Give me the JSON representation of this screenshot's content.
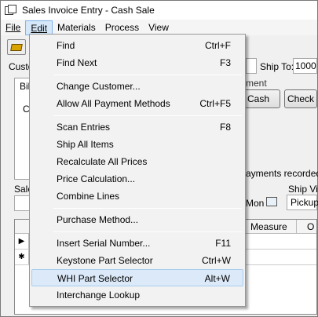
{
  "window": {
    "title": "Sales Invoice Entry - Cash Sale"
  },
  "menubar": {
    "file": "File",
    "edit": "Edit",
    "materials": "Materials",
    "process": "Process",
    "view": "View"
  },
  "form": {
    "customer_label": "Custo",
    "ship_to_label": "Ship To:",
    "ship_to_value": "1000",
    "payment_label": "ment",
    "cash_label": "Cash",
    "check_label": "Check",
    "bill_label": "Bil",
    "c_label": "C",
    "payments_text": "ayments recorded.",
    "sales_label": "Sale",
    "ship_via_label": "Ship Via",
    "mon_label": "Mon",
    "pickup_label": "Pickup"
  },
  "grid": {
    "measure_header": "Measure",
    "o_header": "O",
    "row1_marker": "▶",
    "row2_marker": "✱"
  },
  "edit_menu": {
    "items": [
      {
        "label": "Find",
        "shortcut": "Ctrl+F"
      },
      {
        "label": "Find Next",
        "shortcut": "F3"
      },
      {
        "label": "Change Customer...",
        "shortcut": ""
      },
      {
        "label": "Allow All Payment Methods",
        "shortcut": "Ctrl+F5"
      },
      {
        "label": "Scan Entries",
        "shortcut": "F8"
      },
      {
        "label": "Ship All Items",
        "shortcut": ""
      },
      {
        "label": "Recalculate All Prices",
        "shortcut": ""
      },
      {
        "label": "Price Calculation...",
        "shortcut": ""
      },
      {
        "label": "Combine Lines",
        "shortcut": ""
      },
      {
        "label": "Purchase Method...",
        "shortcut": ""
      },
      {
        "label": "Insert Serial Number...",
        "shortcut": "F11"
      },
      {
        "label": "Keystone Part Selector",
        "shortcut": "Ctrl+W"
      },
      {
        "label": "WHI Part Selector",
        "shortcut": "Alt+W"
      },
      {
        "label": "Interchange Lookup",
        "shortcut": ""
      }
    ]
  }
}
